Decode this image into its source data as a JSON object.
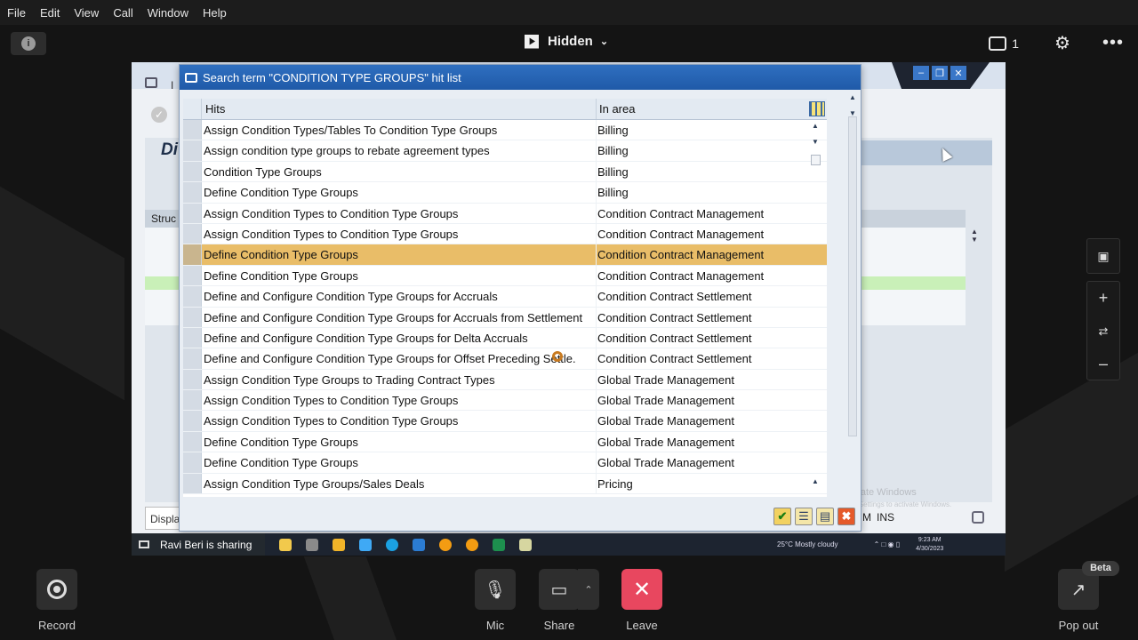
{
  "menubar": [
    "File",
    "Edit",
    "View",
    "Call",
    "Window",
    "Help"
  ],
  "header": {
    "visibility_label": "Hidden",
    "chat_count": "1"
  },
  "background_sap": {
    "title_initial": "I",
    "heading_fragment": "Di",
    "struct_label": "Struc",
    "display_label": "Displa",
    "status_m": "M",
    "status_ins": "INS",
    "watermark_line1": "Activate Windows",
    "watermark_line2": "Go to Settings to activate Windows."
  },
  "dialog": {
    "title": "Search term \"CONDITION TYPE GROUPS\" hit list",
    "columns": {
      "hits": "Hits",
      "area": "In area"
    },
    "rows": [
      {
        "hit": "Assign Condition Types/Tables To Condition Type Groups",
        "area": "Billing"
      },
      {
        "hit": "Assign condition type groups to rebate agreement types",
        "area": "Billing"
      },
      {
        "hit": "Condition Type Groups",
        "area": "Billing"
      },
      {
        "hit": "Define Condition Type Groups",
        "area": "Billing"
      },
      {
        "hit": "Assign Condition Types to Condition Type Groups",
        "area": "Condition Contract Management"
      },
      {
        "hit": "Assign Condition Types to Condition Type Groups",
        "area": "Condition Contract Management"
      },
      {
        "hit": "Define Condition Type Groups",
        "area": "Condition Contract Management"
      },
      {
        "hit": "Define Condition Type Groups",
        "area": "Condition Contract Management"
      },
      {
        "hit": "Define and Configure Condition Type Groups for Accruals",
        "area": "Condition Contract Settlement"
      },
      {
        "hit": "Define and Configure Condition Type Groups for Accruals from Settlement",
        "area": "Condition Contract Settlement"
      },
      {
        "hit": "Define and Configure Condition Type Groups for Delta Accruals",
        "area": "Condition Contract Settlement"
      },
      {
        "hit": "Define and Configure Condition Type Groups for Offset Preceding Settle.",
        "area": "Condition Contract Settlement"
      },
      {
        "hit": "Assign Condition Type Groups to Trading Contract Types",
        "area": "Global Trade Management"
      },
      {
        "hit": "Assign Condition Types to Condition Type Groups",
        "area": "Global Trade Management"
      },
      {
        "hit": "Assign Condition Types to Condition Type Groups",
        "area": "Global Trade Management"
      },
      {
        "hit": "Define Condition Type Groups",
        "area": "Global Trade Management"
      },
      {
        "hit": "Define Condition Type Groups",
        "area": "Global Trade Management"
      },
      {
        "hit": "Assign Condition Type Groups/Sales Deals",
        "area": "Pricing"
      }
    ],
    "highlighted_row": 6,
    "highlight_color": "#e9bd68"
  },
  "taskbar": {
    "sharing_text": "Ravi Beri is sharing",
    "weather": "25°C  Mostly cloudy",
    "time": "9:23 AM",
    "date": "4/30/2023"
  },
  "controls": {
    "record": "Record",
    "mic": "Mic",
    "share": "Share",
    "leave": "Leave",
    "popout": "Pop out",
    "beta": "Beta"
  },
  "colors": {
    "leave_button": "#e8475f",
    "dialog_titlebar": "#2f6fc0"
  }
}
